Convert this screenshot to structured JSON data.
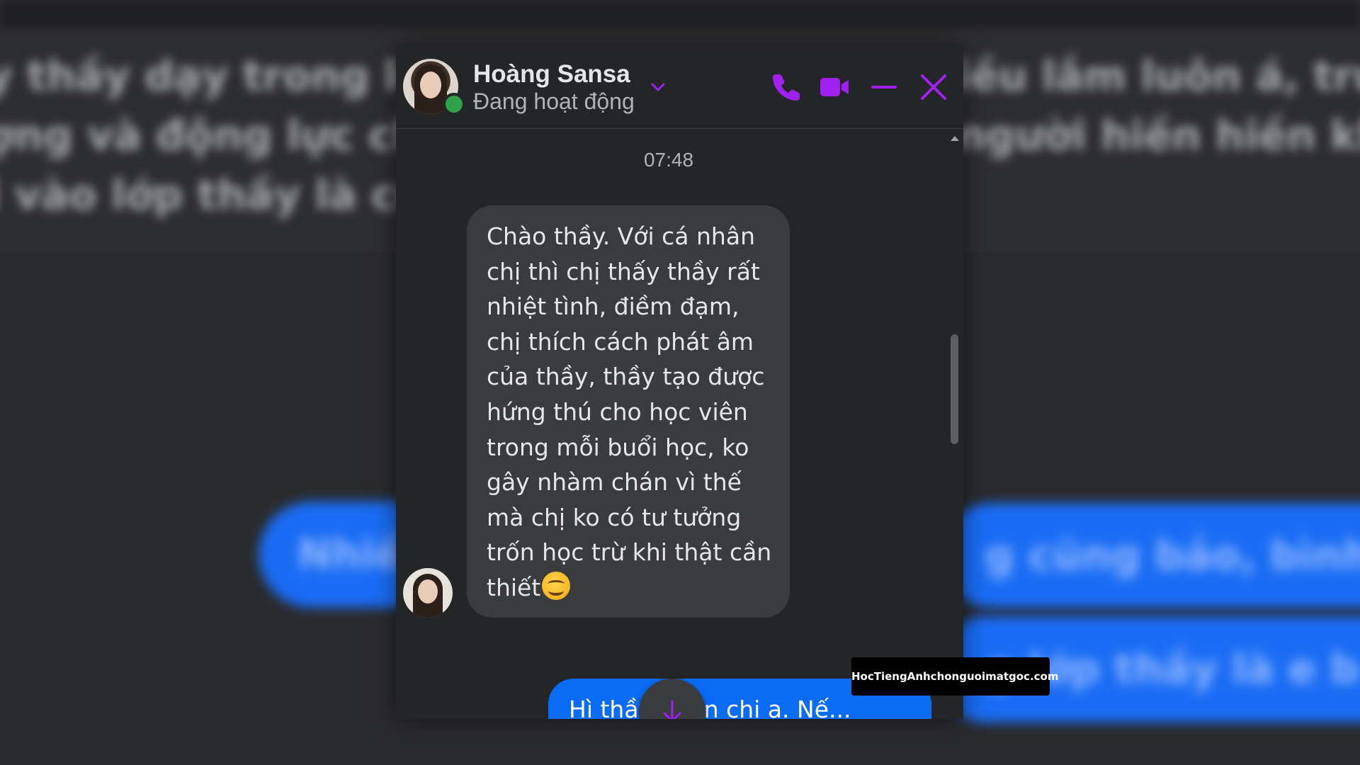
{
  "chat": {
    "contact_name": "Hoàng Sansa",
    "status": "Đang hoạt động",
    "header_icons": [
      "phone-icon",
      "video-icon",
      "minimize-icon",
      "close-icon"
    ],
    "accent_color": "#a020f0",
    "timestamp": "07:48",
    "incoming_message": "Chào thầy. Với cá nhân\nchị thì chị thấy thầy rất\nnhiệt tình, điềm đạm,\nchị thích cách phát âm\ncủa thầy, thầy tạo được\nhứng thú cho học viên\ntrong mỗi buổi học, ko\ngây nhàm chán vì thế\nmà chị ko có tư tưởng\ntrốn học trừ khi thật cần\nthiết",
    "incoming_emoji": "smiling-face-emoji",
    "outgoing_message": "Hì thầy ... ơn chị ạ. Nế...\nkhông b... rộng mà thu xếp",
    "scroll_down_icon": "arrow-down-icon"
  },
  "background": {
    "blurred_text_left": [
      "y thầy dạy trong lớp",
      "ợng và động lực ch",
      "i vào lớp thầy là cũ"
    ],
    "blurred_text_right": [
      "iều lắm luôn á, truy",
      "người hiền hiền khôn",
      ""
    ],
    "blurred_bubbles": [
      "Nhiề",
      "g cũng bảo, bình thư",
      "g lớp thầy là e b"
    ]
  },
  "watermark": "HocTiengAnhchonguoimatgoc.com"
}
